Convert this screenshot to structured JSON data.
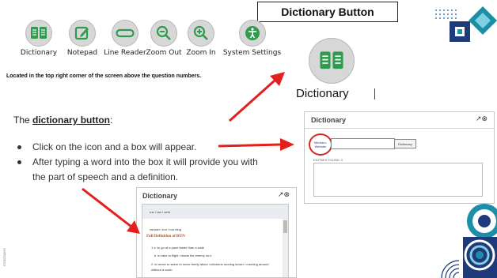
{
  "toolbar": {
    "items": [
      {
        "label": "Dictionary",
        "icon": "book-icon"
      },
      {
        "label": "Notepad",
        "icon": "notepad-icon"
      },
      {
        "label": "Line Reader",
        "icon": "line-reader-icon"
      },
      {
        "label": "Zoom Out",
        "icon": "zoom-out-icon"
      },
      {
        "label": "Zoom In",
        "icon": "zoom-in-icon"
      },
      {
        "label": "System Settings",
        "icon": "accessibility-icon"
      }
    ]
  },
  "header": {
    "title": "Dictionary Button"
  },
  "location_note": "Located in the top right corner of the screen above the question numbers.",
  "dictionary_button": {
    "label": "Dictionary"
  },
  "intro": {
    "prefix": "The ",
    "term": "dictionary button",
    "suffix": ":"
  },
  "bullets": [
    "Click on the icon and a box will appear.",
    "After typing a word into the box it will provide you with the part of speech and a definition."
  ],
  "dictionary_panel": {
    "title": "Dictionary",
    "logo_text": "Merriam-Webster",
    "input_value": "",
    "lookup_button": "Dictionary",
    "entries_found": "ENTRIES FOUND: 0"
  },
  "result_panel": {
    "title": "Dictionary",
    "headword": "run \\ ran \\ verb",
    "pronunciation": "ran\\ran \\ run / run·ning",
    "full_definition": "Full Definition of RUN",
    "definitions": [
      "1  a :to go at a pace faster than a walk",
      "b :to take to flight <made the enemy run>",
      "2 :to move or seem to move freely about <chickens running loose> <running around without a coat>"
    ]
  },
  "colors": {
    "icon_green": "#2f9b4f",
    "arrow_red": "#e3201b",
    "navy": "#1f3a7a",
    "teal": "#1c8fa6",
    "panel_grey": "#d7d7d7"
  },
  "side_id": "EG00TA4HS"
}
